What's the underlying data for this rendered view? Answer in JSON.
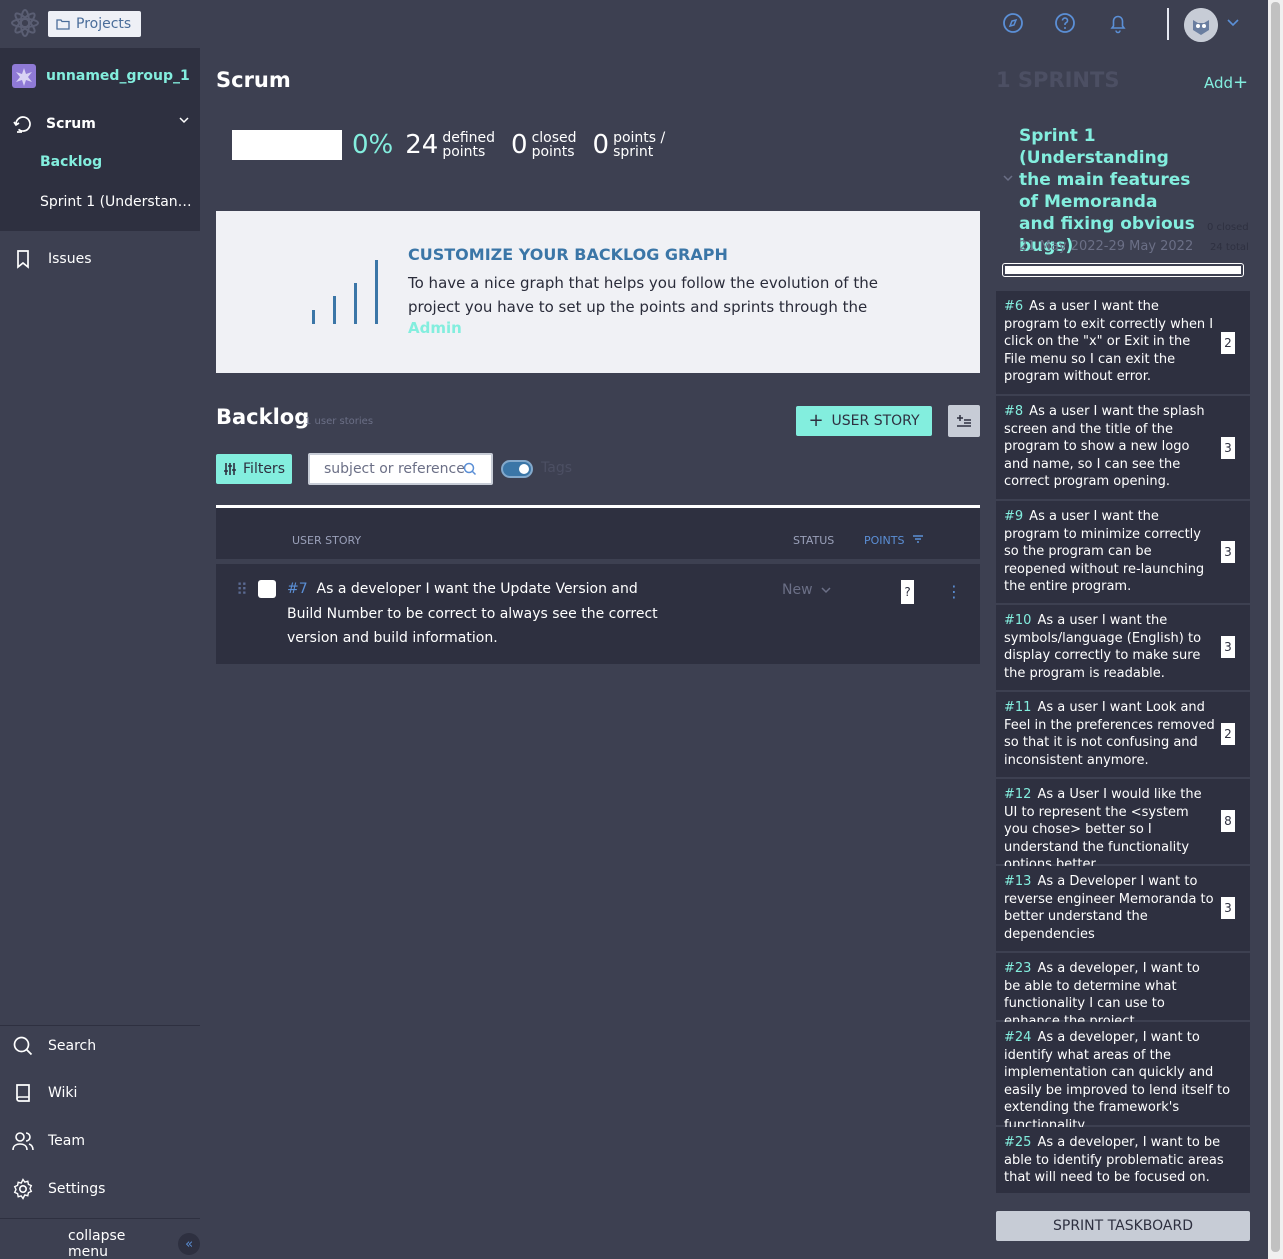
{
  "topbar": {
    "projects_label": "Projects",
    "icons": [
      "compass-icon",
      "help-icon",
      "bell-icon",
      "avatar",
      "chevron-down-icon"
    ]
  },
  "sidebar": {
    "project_name": "unnamed_group_1",
    "scrum_label": "Scrum",
    "backlog_label": "Backlog",
    "sprint_label": "Sprint 1 (Understanding the main features of Memoranda and fixing obvious bugs)",
    "issues_label": "Issues",
    "search_label": "Search",
    "wiki_label": "Wiki",
    "team_label": "Team",
    "settings_label": "Settings",
    "collapse_label": "collapse menu"
  },
  "main": {
    "title": "Scrum",
    "stats": {
      "percent": "0%",
      "defined_points": "24",
      "defined_label_1": "defined",
      "defined_label_2": "points",
      "closed_points": "0",
      "closed_label_1": "closed",
      "closed_label_2": "points",
      "points_sprint": "0",
      "ps_label_1": "points /",
      "ps_label_2": "sprint"
    },
    "graph": {
      "title": "CUSTOMIZE YOUR BACKLOG GRAPH",
      "text": "To have a nice graph that helps you follow the evolution of the project you have to set up the points and sprints through the",
      "link": "Admin"
    },
    "backlog": {
      "title": "Backlog",
      "count": "1 user stories",
      "add_button": "USER STORY",
      "filters_button": "Filters",
      "search_placeholder": "subject or reference",
      "tags_label": "Tags",
      "columns": {
        "story": "USER STORY",
        "status": "STATUS",
        "points": "POINTS"
      },
      "rows": [
        {
          "ref": "#7",
          "text": "As a developer I want the Update Version and Build Number to be correct to always see the correct version and build information.",
          "status": "New",
          "points": "?"
        }
      ]
    }
  },
  "sprints": {
    "header": "1 SPRINTS",
    "add_label": "Add",
    "sprint": {
      "name": "Sprint 1 (Understanding the main features of Memoranda and fixing obvious bugs)",
      "dates": "21 May 2022-29 May 2022",
      "closed": "0 closed",
      "total": "24 total",
      "progress": 0
    },
    "stories": [
      {
        "ref": "#6",
        "text": "As a user I want the program to exit correctly when I click on the \"x\" or Exit in the File menu so I can exit the program without error.",
        "points": "2"
      },
      {
        "ref": "#8",
        "text": "As a user I want the splash screen and the title of the program to show a new logo and name, so I can see the correct program opening.",
        "points": "3"
      },
      {
        "ref": "#9",
        "text": "As a user I want the program to minimize correctly so the program can be reopened without re-launching the entire program.",
        "points": "3"
      },
      {
        "ref": "#10",
        "text": "As a user I want the symbols/language (English) to display correctly to make sure the program is readable.",
        "points": "3"
      },
      {
        "ref": "#11",
        "text": "As a user I want Look and Feel in the preferences removed so that it is not confusing and inconsistent anymore.",
        "points": "2"
      },
      {
        "ref": "#12",
        "text": "As a User I would like the UI to represent the <system you chose> better so I understand the functionality options better.",
        "points": "8"
      },
      {
        "ref": "#13",
        "text": "As a Developer I want to reverse engineer Memoranda to better understand the dependencies",
        "points": "3"
      },
      {
        "ref": "#23",
        "text": "As a developer, I want to be able to determine what functionality I can use to enhance the project",
        "points": ""
      },
      {
        "ref": "#24",
        "text": "As a developer, I want to identify what areas of the implementation can quickly and easily be improved to lend itself to extending the framework's functionality",
        "points": ""
      },
      {
        "ref": "#25",
        "text": "As a developer, I want to be able to identify problematic areas that will need to be focused on.",
        "points": ""
      }
    ],
    "taskboard_button": "SPRINT TASKBOARD"
  },
  "colors": {
    "accent": "#83eede",
    "bg": "#3d4051",
    "panel": "#2e3040",
    "link": "#5b8fd6"
  }
}
